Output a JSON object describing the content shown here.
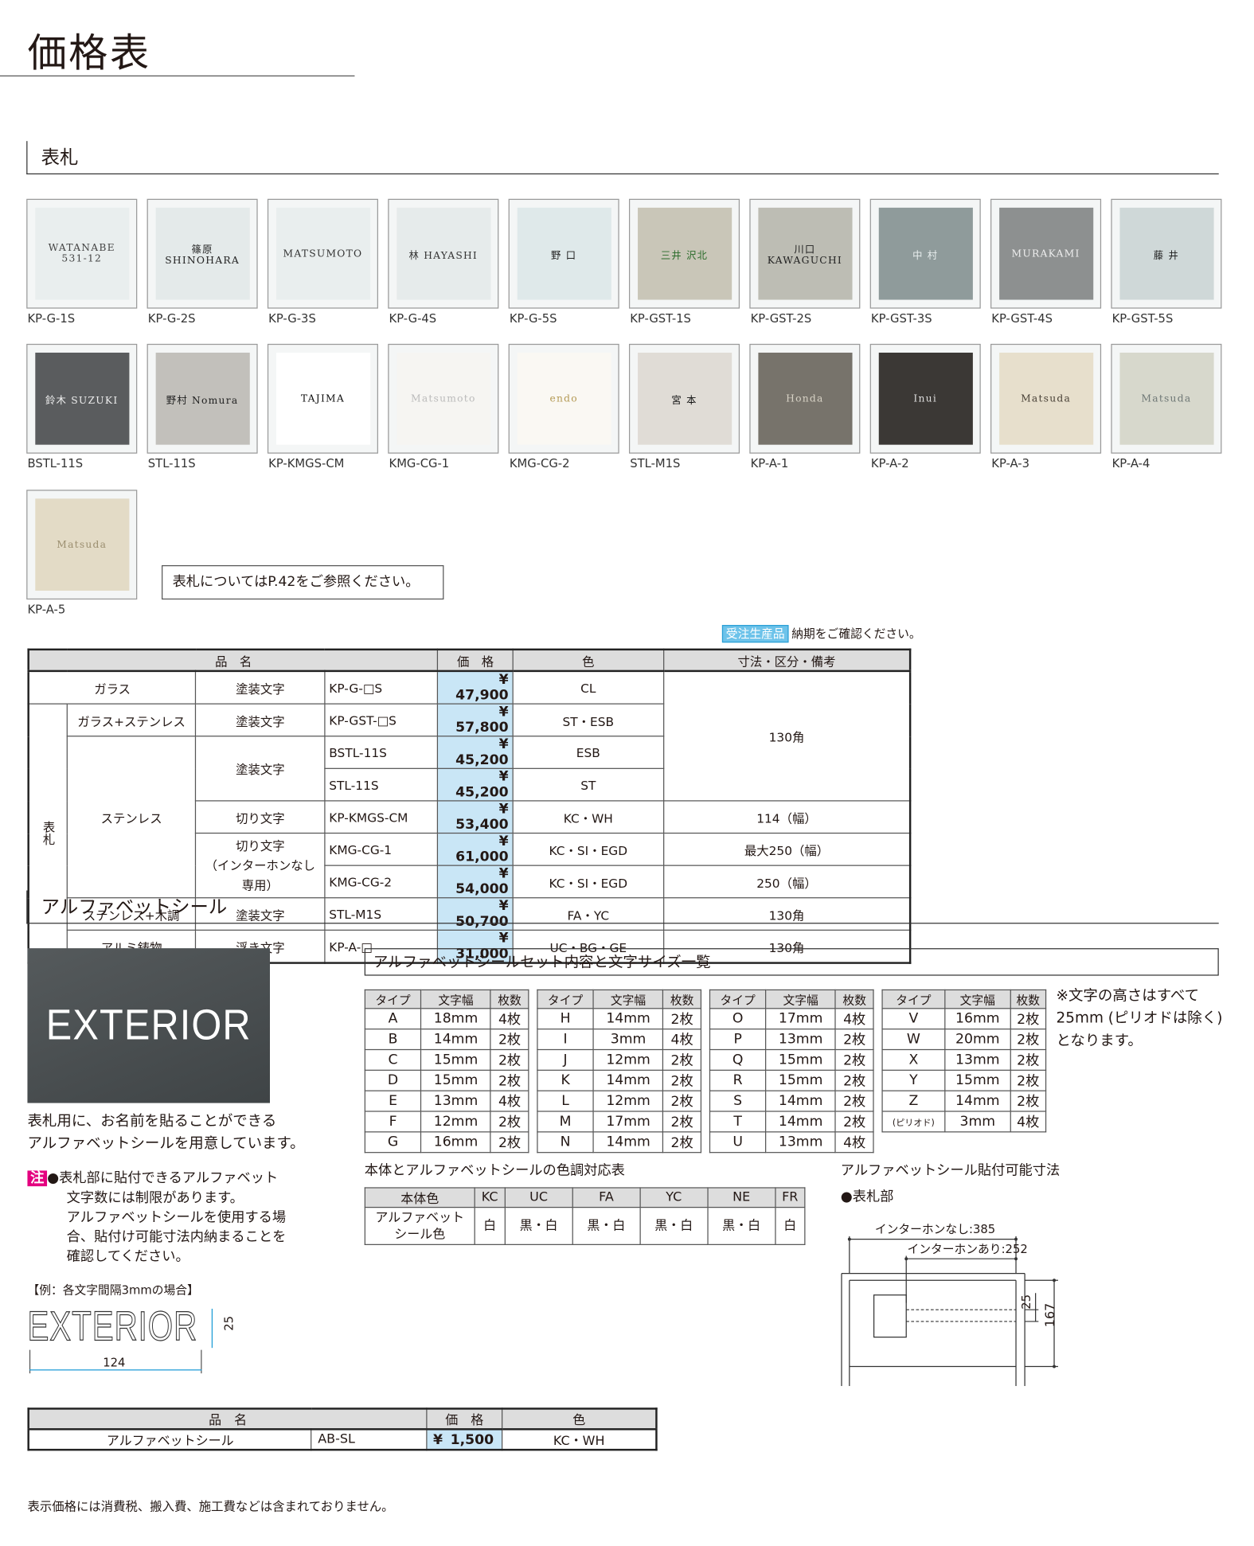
{
  "page_title": "価格表",
  "section1": {
    "title": "表札"
  },
  "thumbnails": [
    {
      "code": "KP-G-1S",
      "text": "WATANABE 531-12",
      "bg": "#e9eeee",
      "fg": "#444"
    },
    {
      "code": "KP-G-2S",
      "text": "篠原 SHINOHARA",
      "bg": "#e4eaea",
      "fg": "#222"
    },
    {
      "code": "KP-G-3S",
      "text": "MATSUMOTO",
      "bg": "#e9eeee",
      "fg": "#333"
    },
    {
      "code": "KP-G-4S",
      "text": "林 HAYASHI",
      "bg": "#e6ebeb",
      "fg": "#333"
    },
    {
      "code": "KP-G-5S",
      "text": "野 口",
      "bg": "#dfe9ea",
      "fg": "#222"
    },
    {
      "code": "KP-GST-1S",
      "text": "三井 沢北",
      "bg": "#c9c6b8",
      "fg": "#2a6b2a"
    },
    {
      "code": "KP-GST-2S",
      "text": "川口 KAWAGUCHI",
      "bg": "#bdbdb4",
      "fg": "#222"
    },
    {
      "code": "KP-GST-3S",
      "text": "中 村",
      "bg": "#8f9b9b",
      "fg": "#e8eeee"
    },
    {
      "code": "KP-GST-4S",
      "text": "MURAKAMI",
      "bg": "#8d9090",
      "fg": "#eee"
    },
    {
      "code": "KP-GST-5S",
      "text": "藤 井",
      "bg": "#cfd8d8",
      "fg": "#222"
    },
    {
      "code": "BSTL-11S",
      "text": "鈴木 SUZUKI",
      "bg": "#5a5c5e",
      "fg": "#eee"
    },
    {
      "code": "STL-11S",
      "text": "野村 Nomura",
      "bg": "#c2c0bb",
      "fg": "#222"
    },
    {
      "code": "KP-KMGS-CM",
      "text": "TAJIMA",
      "bg": "#ffffff",
      "fg": "#111"
    },
    {
      "code": "KMG-CG-1",
      "text": "Matsumoto",
      "bg": "#f6f5f2",
      "fg": "#bbb"
    },
    {
      "code": "KMG-CG-2",
      "text": "endo",
      "bg": "#faf8f3",
      "fg": "#b49a55"
    },
    {
      "code": "STL-M1S",
      "text": "宮 本",
      "bg": "#e0dcd6",
      "fg": "#111"
    },
    {
      "code": "KP-A-1",
      "text": "Honda",
      "bg": "#77736b",
      "fg": "#d8d3c6"
    },
    {
      "code": "KP-A-2",
      "text": "Inui",
      "bg": "#3b3835",
      "fg": "#ddd"
    },
    {
      "code": "KP-A-3",
      "text": "Matsuda",
      "bg": "#e7dfcc",
      "fg": "#4a4238"
    },
    {
      "code": "KP-A-4",
      "text": "Matsuda",
      "bg": "#d7d8cc",
      "fg": "#6f7876"
    },
    {
      "code": "KP-A-5",
      "text": "Matsuda",
      "bg": "#e3dbc6",
      "fg": "#9c8f70"
    }
  ],
  "ref_note": "表札についてはP.42をご参照ください。",
  "order_note": {
    "badge": "受注生産品",
    "text": "納期をご確認ください。"
  },
  "price_table": {
    "headers": {
      "name": "品　名",
      "price": "価　格",
      "color": "色",
      "remarks": "寸法・区分・備考"
    },
    "group_label": "表札",
    "rows": [
      {
        "material": "ガラス",
        "type": "塗装文字",
        "code": "KP-G-□S",
        "price": "¥ 47,900",
        "color": "CL",
        "remarks": "130角"
      },
      {
        "material": "ガラス+ステンレス",
        "type": "塗装文字",
        "code": "KP-GST-□S",
        "price": "¥ 57,800",
        "color": "ST・ESB"
      },
      {
        "material": "ステンレス",
        "type": "塗装文字",
        "code": "BSTL-11S",
        "price": "¥ 45,200",
        "color": "ESB"
      },
      {
        "code": "STL-11S",
        "price": "¥ 45,200",
        "color": "ST"
      },
      {
        "type": "切り文字",
        "code": "KP-KMGS-CM",
        "price": "¥ 53,400",
        "color": "KC・WH",
        "remarks": "114（幅）"
      },
      {
        "type": "切り文字\n（インターホンなし専用）",
        "code": "KMG-CG-1",
        "price": "¥ 61,000",
        "color": "KC・SI・EGD",
        "remarks": "最大250（幅）"
      },
      {
        "code": "KMG-CG-2",
        "price": "¥ 54,000",
        "color": "KC・SI・EGD",
        "remarks": "250（幅）"
      },
      {
        "material": "ステンレス+木調",
        "type": "塗装文字",
        "code": "STL-M1S",
        "price": "¥ 50,700",
        "color": "FA・YC",
        "remarks": "130角"
      },
      {
        "material": "アルミ鋳物",
        "type": "浮き文字",
        "code": "KP-A-□",
        "price": "¥ 31,000",
        "color": "UC・BG・GE",
        "remarks": "130角"
      }
    ]
  },
  "section2": {
    "title": "アルファベットシール"
  },
  "sample_image_text": "EXTERIOR",
  "promo_text": [
    "表札用に、お名前を貼ることができる",
    "アルファベットシールを用意しています。"
  ],
  "caution": {
    "badge": "注",
    "lines": [
      "●表札部に貼付できるアルファベット",
      "文字数には制限があります。",
      "アルファベットシールを使用する場",
      "合、貼付け可能寸法内納まることを",
      "確認してください。"
    ]
  },
  "example": {
    "label": "【例：各文字間隔3mmの場合】",
    "word": "EXTERIOR",
    "height": "25",
    "width": "124"
  },
  "size_list": {
    "title": "アルファベットシールセット内容と文字サイズ一覧",
    "headers": [
      "タイプ",
      "文字幅",
      "枚数"
    ],
    "tables": [
      [
        [
          "A",
          "18mm",
          "4枚"
        ],
        [
          "B",
          "14mm",
          "2枚"
        ],
        [
          "C",
          "15mm",
          "2枚"
        ],
        [
          "D",
          "15mm",
          "2枚"
        ],
        [
          "E",
          "13mm",
          "4枚"
        ],
        [
          "F",
          "12mm",
          "2枚"
        ],
        [
          "G",
          "16mm",
          "2枚"
        ]
      ],
      [
        [
          "H",
          "14mm",
          "2枚"
        ],
        [
          "I",
          "3mm",
          "4枚"
        ],
        [
          "J",
          "12mm",
          "2枚"
        ],
        [
          "K",
          "14mm",
          "2枚"
        ],
        [
          "L",
          "12mm",
          "2枚"
        ],
        [
          "M",
          "17mm",
          "2枚"
        ],
        [
          "N",
          "14mm",
          "2枚"
        ]
      ],
      [
        [
          "O",
          "17mm",
          "4枚"
        ],
        [
          "P",
          "13mm",
          "2枚"
        ],
        [
          "Q",
          "15mm",
          "2枚"
        ],
        [
          "R",
          "15mm",
          "2枚"
        ],
        [
          "S",
          "14mm",
          "2枚"
        ],
        [
          "T",
          "14mm",
          "2枚"
        ],
        [
          "U",
          "13mm",
          "4枚"
        ]
      ],
      [
        [
          "V",
          "16mm",
          "2枚"
        ],
        [
          "W",
          "20mm",
          "2枚"
        ],
        [
          "X",
          "13mm",
          "2枚"
        ],
        [
          "Y",
          "15mm",
          "2枚"
        ],
        [
          "Z",
          "14mm",
          "2枚"
        ],
        [
          "(ピリオド)",
          "3mm",
          "4枚"
        ]
      ]
    ],
    "note": [
      "※文字の高さはすべて",
      "25mm (ピリオドは除く)",
      "となります。"
    ]
  },
  "color_table": {
    "title": "本体とアルファベットシールの色調対応表",
    "header_label": "本体色",
    "body_colors": [
      "KC",
      "UC",
      "FA",
      "YC",
      "NE",
      "FR"
    ],
    "row_label": "アルファベット\nシール色",
    "seal_colors": [
      "白",
      "黒・白",
      "黒・白",
      "黒・白",
      "黒・白",
      "白"
    ]
  },
  "dimension": {
    "title": "アルファベットシール貼付可能寸法",
    "subtitle": "●表札部",
    "without_intercom": "インターホンなし:385",
    "with_intercom": "インターホンあり:252",
    "h1": "25",
    "h2": "167"
  },
  "seal_price": {
    "headers": {
      "name": "品　名",
      "price": "価　格",
      "color": "色"
    },
    "name": "アルファベットシール",
    "code": "AB-SL",
    "yen": "¥",
    "price": "1,500",
    "color": "KC・WH"
  },
  "footer": "表示価格には消費税、搬入費、施工費などは含まれておりません。"
}
